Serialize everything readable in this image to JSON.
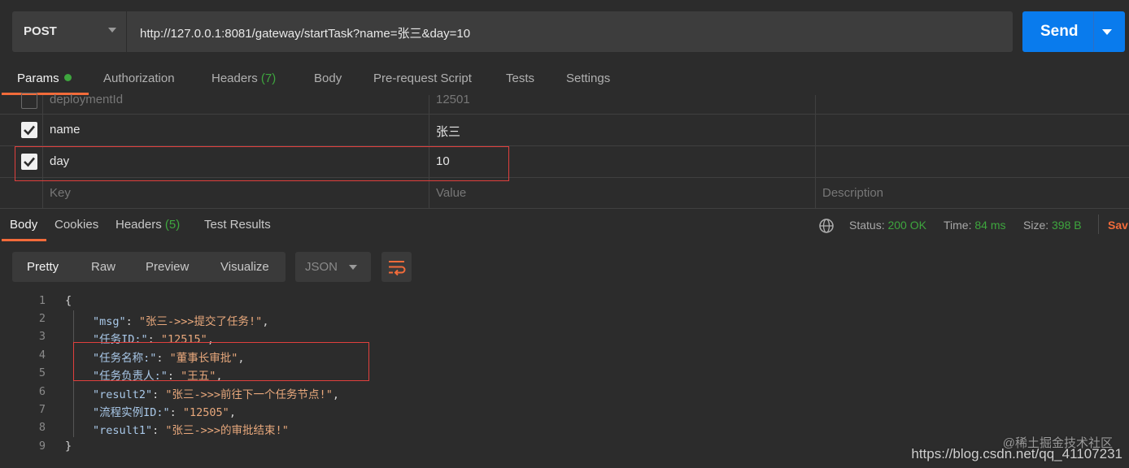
{
  "request": {
    "method": "POST",
    "url": "http://127.0.0.1:8081/gateway/startTask?name=张三&day=10",
    "send_label": "Send"
  },
  "request_tabs": [
    {
      "label": "Params",
      "active": true
    },
    {
      "label": "Authorization"
    },
    {
      "label": "Headers",
      "count": "(7)"
    },
    {
      "label": "Body"
    },
    {
      "label": "Pre-request Script"
    },
    {
      "label": "Tests"
    },
    {
      "label": "Settings"
    }
  ],
  "params": {
    "rows": [
      {
        "key": "deploymentId",
        "value": "12501",
        "checked": false
      },
      {
        "key": "name",
        "value": "张三",
        "checked": true
      },
      {
        "key": "day",
        "value": "10",
        "checked": true
      }
    ],
    "placeholder": {
      "key": "Key",
      "value": "Value",
      "description": "Description"
    }
  },
  "response_tabs": [
    {
      "label": "Body",
      "active": true
    },
    {
      "label": "Cookies"
    },
    {
      "label": "Headers",
      "count": "(5)"
    },
    {
      "label": "Test Results"
    }
  ],
  "response_meta": {
    "status_label": "Status:",
    "status_value": "200 OK",
    "time_label": "Time:",
    "time_value": "84 ms",
    "size_label": "Size:",
    "size_value": "398 B",
    "save_label": "Sav"
  },
  "view_modes": [
    "Pretty",
    "Raw",
    "Preview",
    "Visualize"
  ],
  "format": "JSON",
  "code_lines": [
    {
      "n": "1",
      "text": "{"
    },
    {
      "n": "2",
      "key": "\"msg\"",
      "value": "\"张三->>>提交了任务!\"",
      "comma": ","
    },
    {
      "n": "3",
      "key": "\"任务ID:\"",
      "value": "\"12515\"",
      "comma": ","
    },
    {
      "n": "4",
      "key": "\"任务名称:\"",
      "value": "\"董事长审批\"",
      "comma": ","
    },
    {
      "n": "5",
      "key": "\"任务负责人:\"",
      "value": "\"王五\"",
      "comma": ","
    },
    {
      "n": "6",
      "key": "\"result2\"",
      "value": "\"张三->>>前往下一个任务节点!\"",
      "comma": ","
    },
    {
      "n": "7",
      "key": "\"流程实例ID:\"",
      "value": "\"12505\"",
      "comma": ","
    },
    {
      "n": "8",
      "key": "\"result1\"",
      "value": "\"张三->>>的审批结束!\"",
      "comma": ""
    },
    {
      "n": "9",
      "text": "}"
    }
  ],
  "watermark": "https://blog.csdn.net/qq_41107231",
  "watermark2": "@稀土掘金技术社区"
}
